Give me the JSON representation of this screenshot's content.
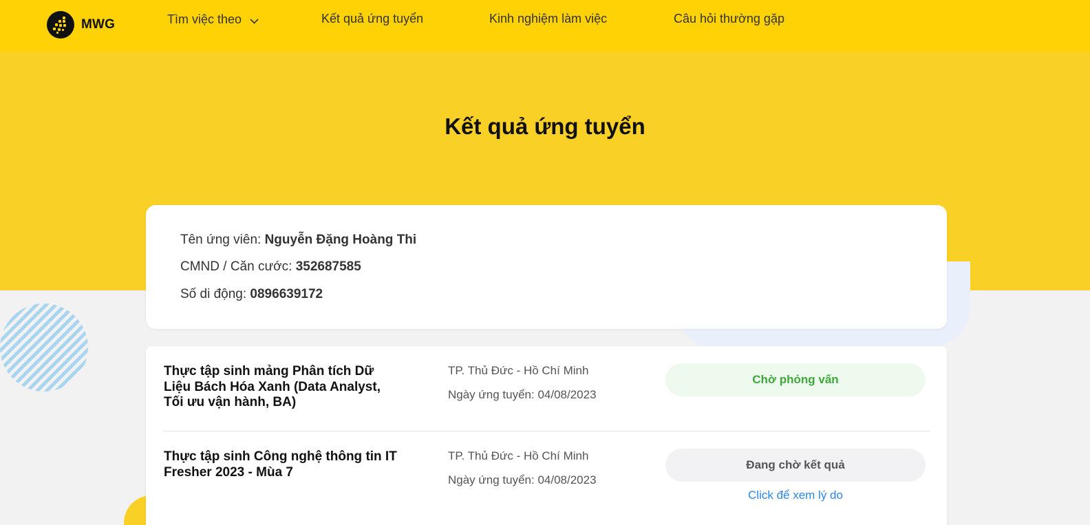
{
  "nav": {
    "brand": "MWG",
    "items": [
      {
        "label": "Tìm việc theo",
        "has_dropdown": true
      },
      {
        "label": "Kết quả ứng tuyển"
      },
      {
        "label": "Kinh nghiệm làm việc"
      },
      {
        "label": "Câu hỏi thường gặp"
      }
    ]
  },
  "hero": {
    "title": "Kết quả ứng tuyển"
  },
  "candidate": {
    "name_label": "Tên ứng viên:",
    "name": "Nguyễn Đặng Hoàng Thi",
    "id_label": "CMND / Căn cước:",
    "id_number": "352687585",
    "phone_label": "Số di động:",
    "phone": "0896639172"
  },
  "applications": [
    {
      "title": "Thực tập sinh mảng Phân tích Dữ Liệu Bách Hóa Xanh (Data Analyst, Tối ưu vận hành, BA)",
      "location": "TP. Thủ Đức - Hồ Chí Minh",
      "applied_date": "Ngày ứng tuyển: 04/08/2023",
      "status": "Chờ phỏng vấn"
    },
    {
      "title": "Thực tập sinh Công nghệ thông tin IT Fresher 2023 - Mùa 7",
      "location": "TP. Thủ Đức - Hồ Chí Minh",
      "applied_date": "Ngày ứng tuyển: 04/08/2023",
      "status": "Đang chờ kết quả",
      "link": "Click để xem lý do"
    }
  ],
  "colors": {
    "nav_bg": "#ffd206",
    "hero_bg": "#f9d126",
    "status_green": "#3ea83a",
    "link_blue": "#2a86e8"
  },
  "icons": [
    "mwg-logo-icon",
    "chevron-down-icon"
  ]
}
